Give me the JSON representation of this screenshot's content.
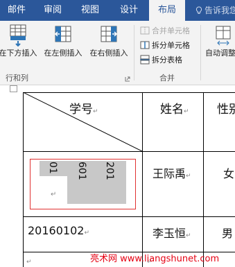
{
  "tabs": [
    {
      "label": "邮件"
    },
    {
      "label": "审阅"
    },
    {
      "label": "视图"
    },
    {
      "label": "设计"
    },
    {
      "label": "布局"
    }
  ],
  "tell_me": "告诉我您",
  "ribbon": {
    "insert_below": "在下方插入",
    "insert_left": "在左侧插入",
    "insert_right": "在右侧插入",
    "group_rows_cols": "行和列",
    "merge_cells": "合并单元格",
    "split_cells": "拆分单元格",
    "split_table": "拆分表格",
    "group_merge": "合并",
    "autofit": "自动调整"
  },
  "table": {
    "header_col1": "学号",
    "header_col2": "姓名",
    "header_col3": "性别",
    "row1_id_cols": [
      "201",
      "601",
      "01"
    ],
    "row1_name": "王际禹",
    "row1_gender": "女",
    "row2_id": "20160102",
    "row2_name": "李玉恒",
    "row2_gender": "男"
  },
  "watermark": "亮术网 www.liangshunet.com",
  "colors": {
    "tab_bar": "#2b579a",
    "ribbon_bg": "#f3f3f3",
    "selection": "#c8c8c8",
    "cell_border_highlight": "#e03030",
    "watermark": "#e60012"
  }
}
